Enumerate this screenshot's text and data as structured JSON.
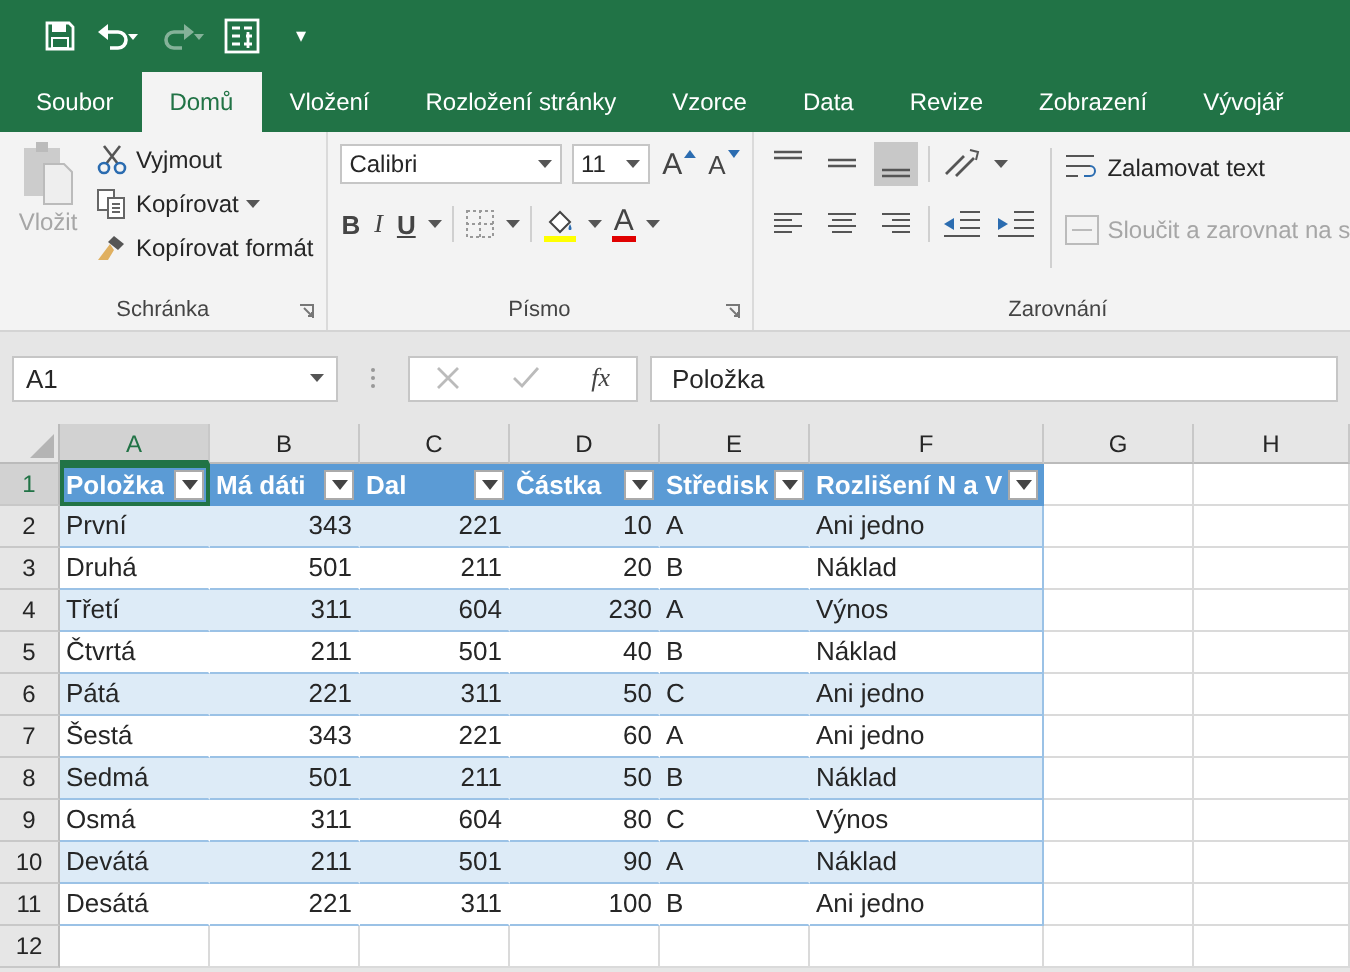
{
  "quick_access": {
    "customize": "▾"
  },
  "tabs": [
    {
      "label": "Soubor",
      "selected": false
    },
    {
      "label": "Domů",
      "selected": true
    },
    {
      "label": "Vložení",
      "selected": false
    },
    {
      "label": "Rozložení stránky",
      "selected": false
    },
    {
      "label": "Vzorce",
      "selected": false
    },
    {
      "label": "Data",
      "selected": false
    },
    {
      "label": "Revize",
      "selected": false
    },
    {
      "label": "Zobrazení",
      "selected": false
    },
    {
      "label": "Vývojář",
      "selected": false
    }
  ],
  "ribbon": {
    "clipboard": {
      "paste": {
        "label": "Vložit",
        "disabled": true
      },
      "cut": "Vyjmout",
      "copy": "Kopírovat",
      "format_painter": "Kopírovat formát",
      "group": "Schránka"
    },
    "font": {
      "font_name": "Calibri",
      "font_size": "11",
      "grow": "A",
      "shrink": "A",
      "bold": "B",
      "italic": "I",
      "underline": "U",
      "font_color": "A",
      "group": "Písmo"
    },
    "alignment": {
      "vertical": [
        {
          "selected": false
        },
        {
          "selected": false
        },
        {
          "selected": true
        }
      ],
      "wrap_text": {
        "label": "Zalamovat text",
        "disabled": false
      },
      "merge": {
        "label": "Sloučit a zarovnat na s",
        "disabled": true
      },
      "group": "Zarovnání"
    }
  },
  "formula_bar": {
    "name_box": "A1",
    "function_label": "fx",
    "content": "Položka"
  },
  "sheet": {
    "columns": [
      {
        "label": "A",
        "selected": true
      },
      {
        "label": "B",
        "selected": false
      },
      {
        "label": "C",
        "selected": false
      },
      {
        "label": "D",
        "selected": false
      },
      {
        "label": "E",
        "selected": false
      },
      {
        "label": "F",
        "selected": false
      },
      {
        "label": "G",
        "selected": false
      },
      {
        "label": "H",
        "selected": false
      }
    ],
    "row_numbers": [
      "1",
      "2",
      "3",
      "4",
      "5",
      "6",
      "7",
      "8",
      "9",
      "10",
      "11",
      "12"
    ],
    "table_headers": [
      "Položka",
      "Má dáti",
      "Dal",
      "Částka",
      "Středisk",
      "Rozlišení N a V"
    ],
    "table_rows": [
      [
        "První",
        "343",
        "221",
        "10",
        "A",
        "Ani jedno"
      ],
      [
        "Druhá",
        "501",
        "211",
        "20",
        "B",
        "Náklad"
      ],
      [
        "Třetí",
        "311",
        "604",
        "230",
        "A",
        "Výnos"
      ],
      [
        "Čtvrtá",
        "211",
        "501",
        "40",
        "B",
        "Náklad"
      ],
      [
        "Pátá",
        "221",
        "311",
        "50",
        "C",
        "Ani jedno"
      ],
      [
        "Šestá",
        "343",
        "221",
        "60",
        "A",
        "Ani jedno"
      ],
      [
        "Sedmá",
        "501",
        "211",
        "50",
        "B",
        "Náklad"
      ],
      [
        "Osmá",
        "311",
        "604",
        "80",
        "C",
        "Výnos"
      ],
      [
        "Devátá",
        "211",
        "501",
        "90",
        "A",
        "Náklad"
      ],
      [
        "Desátá",
        "221",
        "311",
        "100",
        "B",
        "Ani jedno"
      ]
    ]
  }
}
